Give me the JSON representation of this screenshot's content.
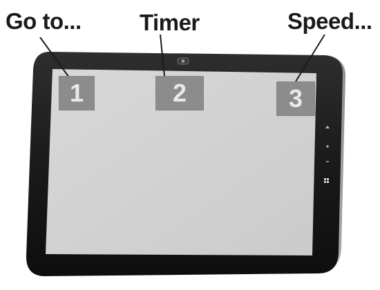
{
  "labels": [
    {
      "caption": "Go to...",
      "number": "1"
    },
    {
      "caption": "Timer",
      "number": "2"
    },
    {
      "caption": "Speed...",
      "number": "3"
    }
  ],
  "colors": {
    "bezel": "#1c1c1c",
    "screen": "#d2d2d2",
    "tile": "#8c8c8c",
    "tile_text": "#e9e9e9",
    "caption_text": "#1a1a1a"
  },
  "icons": [
    "webcam-icon",
    "windows-logo-icon"
  ]
}
